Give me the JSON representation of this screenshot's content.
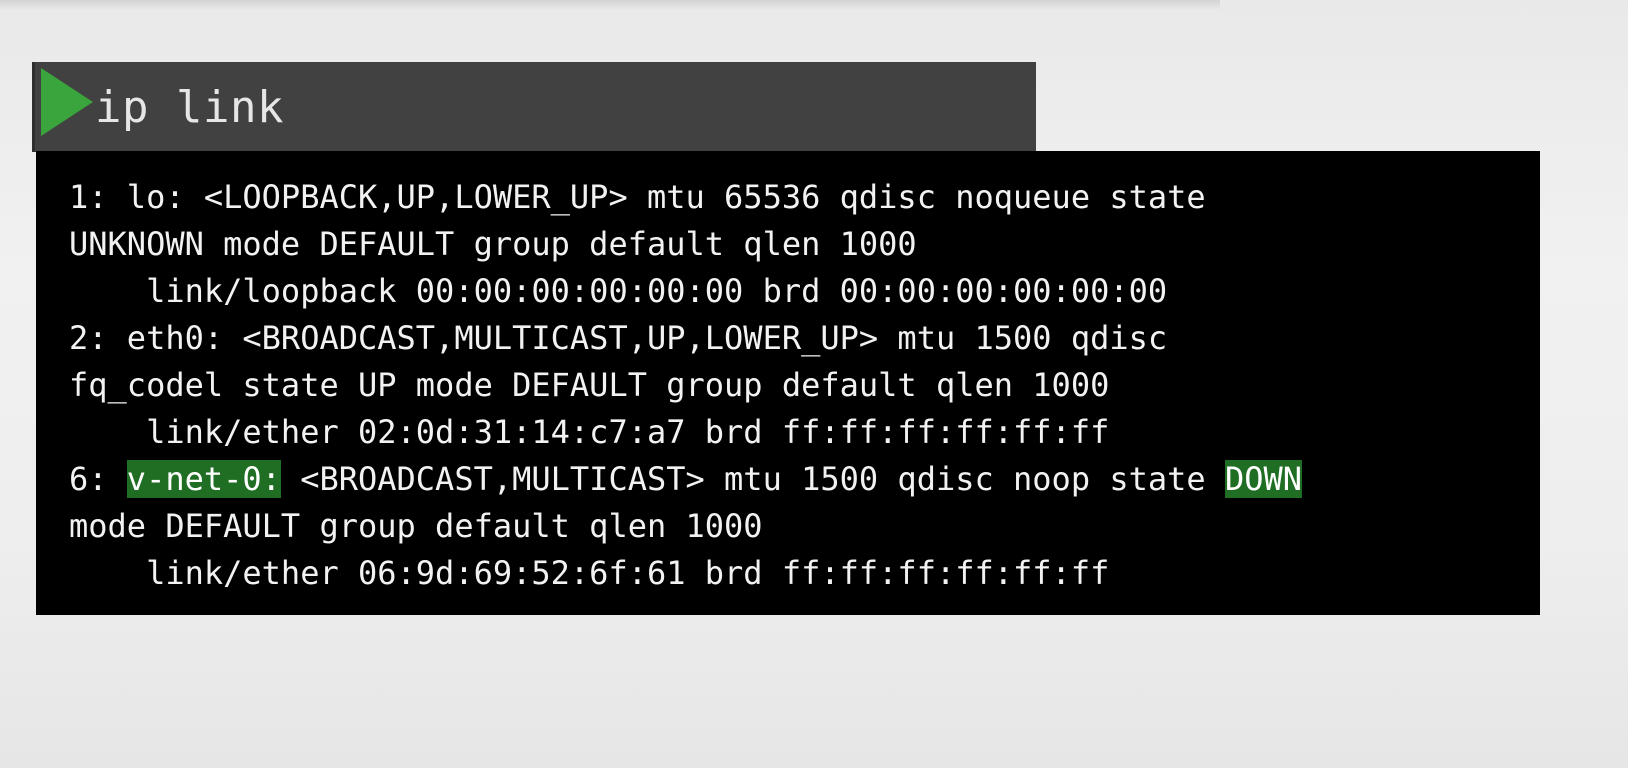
{
  "command_bar": {
    "icon": "play-icon",
    "command": "ip link",
    "colors": {
      "bar": "#414141",
      "icon": "#3aa53c"
    }
  },
  "terminal": {
    "background": "#000000",
    "highlight_color": "#1f6e24",
    "lines": {
      "l1": "1: lo: <LOOPBACK,UP,LOWER_UP> mtu 65536 qdisc noqueue state",
      "l2": "UNKNOWN mode DEFAULT group default qlen 1000",
      "l3": "    link/loopback 00:00:00:00:00:00 brd 00:00:00:00:00:00",
      "l4": "2: eth0: <BROADCAST,MULTICAST,UP,LOWER_UP> mtu 1500 qdisc",
      "l5": "fq_codel state UP mode DEFAULT group default qlen 1000",
      "l6": "    link/ether 02:0d:31:14:c7:a7 brd ff:ff:ff:ff:ff:ff",
      "l7": {
        "prefix": "6: ",
        "interface": "v-net-0:",
        "middle": " <BROADCAST,MULTICAST> mtu 1500 qdisc noop state ",
        "state": "DOWN"
      },
      "l8": "mode DEFAULT group default qlen 1000",
      "l9": "    link/ether 06:9d:69:52:6f:61 brd ff:ff:ff:ff:ff:ff"
    }
  }
}
